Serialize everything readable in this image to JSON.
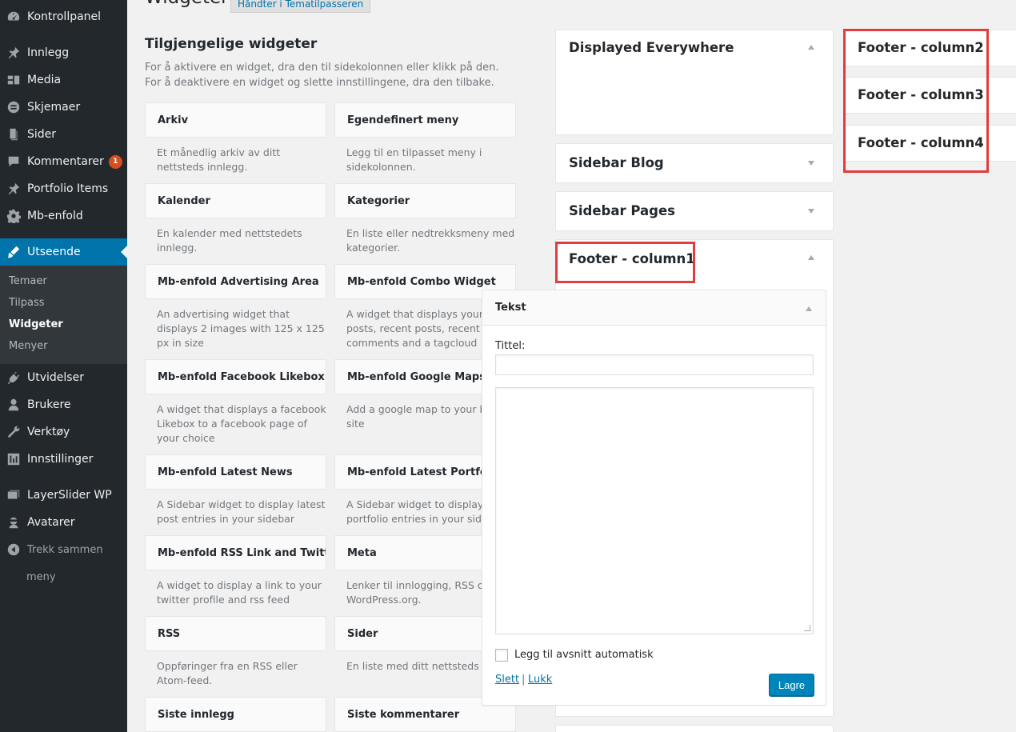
{
  "menu": {
    "items": [
      {
        "label": "Kontrollpanel",
        "icon": "dashboard-icon"
      },
      {
        "label": "Innlegg",
        "icon": "pin-icon"
      },
      {
        "label": "Media",
        "icon": "media-icon"
      },
      {
        "label": "Skjemaer",
        "icon": "forms-icon"
      },
      {
        "label": "Sider",
        "icon": "page-icon"
      },
      {
        "label": "Kommentarer",
        "icon": "comment-icon",
        "badge": "1"
      },
      {
        "label": "Portfolio Items",
        "icon": "pin-icon"
      },
      {
        "label": "Mb-enfold",
        "icon": "gear-icon"
      },
      {
        "label": "Utseende",
        "icon": "brush-icon"
      },
      {
        "label": "Utvidelser",
        "icon": "plugin-icon"
      },
      {
        "label": "Brukere",
        "icon": "user-icon"
      },
      {
        "label": "Verktøy",
        "icon": "wrench-icon"
      },
      {
        "label": "Innstillinger",
        "icon": "settings-icon"
      },
      {
        "label": "LayerSlider WP",
        "icon": "layers-icon"
      },
      {
        "label": "Avatarer",
        "icon": "avatar-icon"
      },
      {
        "label": "Trekk sammen",
        "icon": "collapse-icon"
      },
      {
        "label": "meny"
      }
    ],
    "submenu": [
      "Temaer",
      "Tilpass",
      "Widgeter",
      "Menyer"
    ]
  },
  "header": {
    "title": "Widgeter",
    "action": "Håndter i Tematilpasseren"
  },
  "available": {
    "title": "Tilgjengelige widgeter",
    "description": "For å aktivere en widget, dra den til sidekolonnen eller klikk på den. For å deaktivere en widget og slette innstillingene, dra den tilbake.",
    "widgets": [
      {
        "name": "Arkiv",
        "desc": "Et månedlig arkiv av ditt nettsteds innlegg."
      },
      {
        "name": "Egendefinert meny",
        "desc": "Legg til en tilpasset meny i sidekolonnen."
      },
      {
        "name": "Kalender",
        "desc": "En kalender med nettstedets innlegg."
      },
      {
        "name": "Kategorier",
        "desc": "En liste eller nedtrekksmeny med kategorier."
      },
      {
        "name": "Mb-enfold Advertising Area",
        "desc": "An advertising widget that displays 2 images with 125 x 125 px in size"
      },
      {
        "name": "Mb-enfold Combo Widget",
        "desc": "A widget that displays your posts, recent posts, recent comments and a tagcloud"
      },
      {
        "name": "Mb-enfold Facebook Likebox",
        "desc": "A widget that displays a facebook Likebox to a facebook page of your choice"
      },
      {
        "name": "Mb-enfold Google Maps Wi",
        "desc": "Add a google map to your blog site"
      },
      {
        "name": "Mb-enfold Latest News",
        "desc": "A Sidebar widget to display latest post entries in your sidebar"
      },
      {
        "name": "Mb-enfold Latest Portfolio",
        "desc": "A Sidebar widget to display lat portfolio entries in your sideba"
      },
      {
        "name": "Mb-enfold RSS Link and Twitt...",
        "desc": "A widget to display a link to your twitter profile and rss feed"
      },
      {
        "name": "Meta",
        "desc": "Lenker til innlogging, RSS og WordPress.org."
      },
      {
        "name": "RSS",
        "desc": "Oppføringer fra en RSS eller Atom-feed."
      },
      {
        "name": "Sider",
        "desc": "En liste med ditt nettsteds side"
      },
      {
        "name": "Siste innlegg",
        "desc": ""
      },
      {
        "name": "Siste kommentarer",
        "desc": ""
      }
    ]
  },
  "sidebars": {
    "displayed_everywhere": "Displayed Everywhere",
    "sidebar_blog": "Sidebar Blog",
    "sidebar_pages": "Sidebar Pages",
    "footer_col1": "Footer - column1",
    "footer_col2": "Footer - column2",
    "footer_col3": "Footer - column3",
    "footer_col4": "Footer - column4"
  },
  "tekst_widget": {
    "title": "Tekst",
    "title_label": "Tittel:",
    "title_value": "",
    "body_value": "",
    "auto_paragraph": "Legg til avsnitt automatisk",
    "delete": "Slett",
    "separator": "|",
    "close": "Lukk",
    "save": "Lagre"
  },
  "colors": {
    "sidebar_bg": "#23282d",
    "accent": "#0073aa",
    "highlight_outline": "#e23c3c",
    "badge": "#d54e21"
  }
}
